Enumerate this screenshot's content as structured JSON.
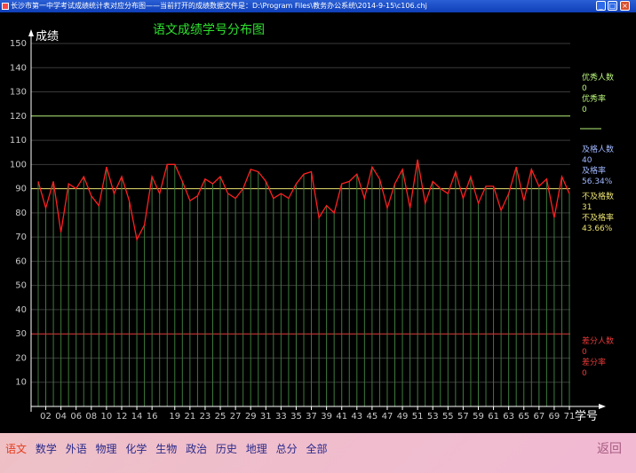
{
  "window": {
    "title": "长沙市第一中学考试成绩统计表对应分布图——当前打开的成绩数据文件是：D:\\Program Files\\教务办公系统\\2014-9-15\\c106.chj",
    "minimize": "_",
    "maximize": "□",
    "close": "×"
  },
  "chart_data": {
    "type": "line",
    "title": "语文成绩学号分布图",
    "ylabel": "成绩",
    "xlabel": "学号",
    "ylim": [
      0,
      150
    ],
    "yticks": [
      10,
      20,
      30,
      40,
      50,
      60,
      70,
      80,
      90,
      100,
      110,
      120,
      130,
      140,
      150
    ],
    "xticks": [
      "02",
      "04",
      "06",
      "08",
      "10",
      "12",
      "14",
      "16",
      "19",
      "21",
      "23",
      "25",
      "27",
      "29",
      "31",
      "33",
      "35",
      "37",
      "39",
      "41",
      "43",
      "45",
      "47",
      "49",
      "51",
      "53",
      "55",
      "57",
      "59",
      "61",
      "63",
      "65",
      "67",
      "69",
      "71"
    ],
    "reference_lines": {
      "excellent": 120,
      "pass": 90,
      "poor": 30
    },
    "grid": true,
    "series": [
      {
        "values": [
          93,
          82,
          93,
          72,
          92,
          90,
          95,
          87,
          83,
          99,
          88,
          95,
          85,
          69,
          75,
          95,
          88,
          100,
          100,
          93,
          85,
          87,
          94,
          92,
          95,
          88,
          86,
          90,
          98,
          97,
          93,
          86,
          88,
          86,
          92,
          96,
          97,
          78,
          83,
          80,
          92,
          93,
          96,
          86,
          99,
          94,
          82,
          92,
          98,
          82,
          102,
          84,
          93,
          90,
          88,
          97,
          86,
          95,
          84,
          91,
          91,
          81,
          88,
          99,
          85,
          98,
          91,
          94,
          78,
          95,
          88
        ]
      }
    ]
  },
  "legend": {
    "excellent_count_label": "优秀人数",
    "excellent_count": "0",
    "excellent_rate_label": "优秀率",
    "excellent_rate": "0",
    "pass_count_label": "及格人数",
    "pass_count": "40",
    "pass_rate_label": "及格率",
    "pass_rate": "56.34%",
    "fail_count_label": "不及格数",
    "fail_count": "31",
    "fail_rate_label": "不及格率",
    "fail_rate": "43.66%",
    "poor_count_label": "差分人数",
    "poor_count": "0",
    "poor_rate_label": "差分率",
    "poor_rate": "0"
  },
  "colors": {
    "excellent": "#b8f27a",
    "pass": "#a0b8ff",
    "fail": "#e8e070",
    "poor": "#e83a3a",
    "series": "#ff2020",
    "title": "#2ee02e"
  },
  "nav": {
    "items": [
      "语文",
      "数学",
      "外语",
      "物理",
      "化学",
      "生物",
      "政治",
      "历史",
      "地理",
      "总分",
      "全部"
    ],
    "active": "语文",
    "back": "返回"
  }
}
